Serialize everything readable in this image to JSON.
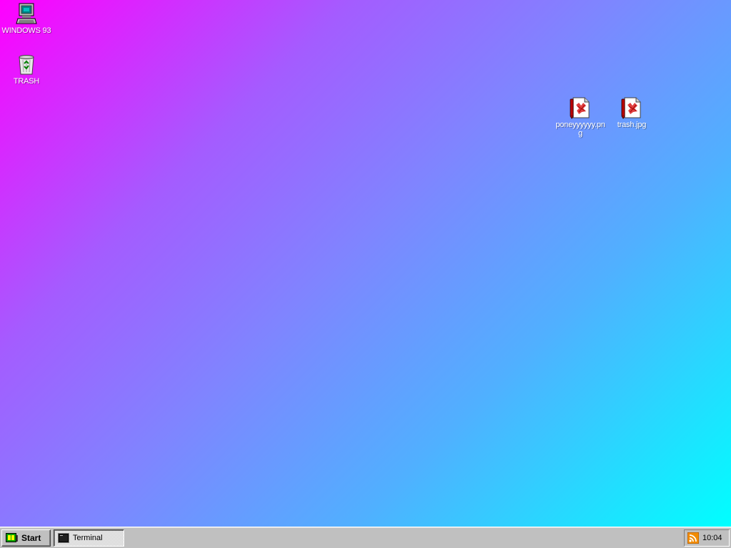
{
  "desktop": {
    "background_colors": [
      "#ff00ff",
      "#a45cff",
      "#7f85ff",
      "#50b0ff",
      "#00ffff"
    ],
    "icons": [
      {
        "label": "WINDOWS 93",
        "icon": "computer-icon"
      },
      {
        "label": "TRASH",
        "icon": "recycle-bin-icon"
      },
      {
        "label": "poneyyyyyy.png",
        "icon": "image-file-icon"
      },
      {
        "label": "trash.jpg",
        "icon": "image-file-icon"
      }
    ]
  },
  "taskbar": {
    "start_label": "Start",
    "tasks": [
      {
        "label": "Terminal",
        "icon": "terminal-icon",
        "active": true
      }
    ],
    "tray": {
      "icon": "rss-icon",
      "clock": "10:04"
    }
  }
}
